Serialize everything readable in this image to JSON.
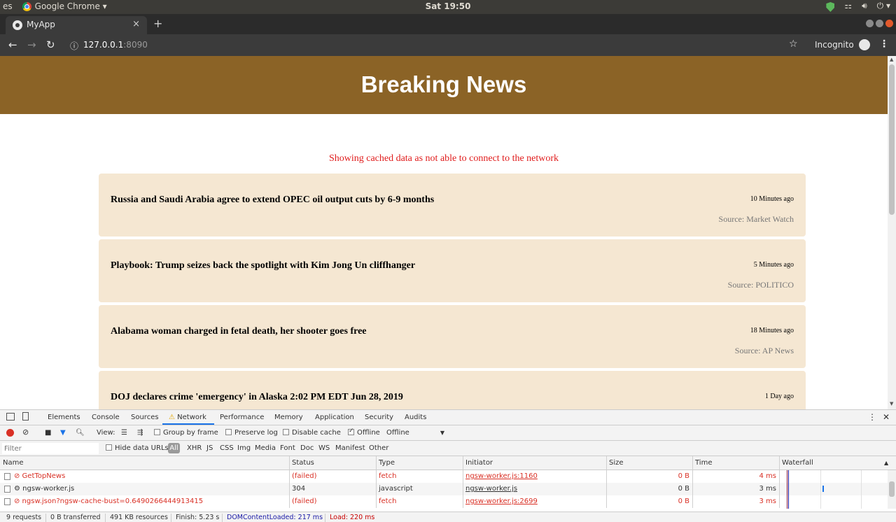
{
  "os": {
    "activities": "es",
    "app_name": "Google Chrome ▾",
    "clock": "Sat 19:50"
  },
  "browser": {
    "tab_title": "MyApp",
    "tab_close": "×",
    "new_tab": "+",
    "url_host": "127.0.0.1",
    "url_port": ":8090",
    "incognito_label": "Incognito"
  },
  "page": {
    "title": "Breaking News",
    "offline_message": "Showing cached data as not able to connect to the network",
    "articles": [
      {
        "headline": "Russia and Saudi Arabia agree to extend OPEC oil output cuts by 6-9 months",
        "ago": "10 Minutes ago",
        "source": "Source: Market Watch"
      },
      {
        "headline": "Playbook: Trump seizes back the spotlight with Kim Jong Un cliffhanger",
        "ago": "5 Minutes ago",
        "source": "Source: POLITICO"
      },
      {
        "headline": "Alabama woman charged in fetal death, her shooter goes free",
        "ago": "18 Minutes ago",
        "source": "Source: AP News"
      },
      {
        "headline": "DOJ declares crime 'emergency' in Alaska 2:02 PM EDT Jun 28, 2019",
        "ago": "1 Day ago",
        "source": ""
      }
    ]
  },
  "devtools": {
    "tabs": [
      "Elements",
      "Console",
      "Sources",
      "Network",
      "Performance",
      "Memory",
      "Application",
      "Security",
      "Audits"
    ],
    "active_tab": "Network",
    "toolbar": {
      "view_label": "View:",
      "group_by_frame": "Group by frame",
      "preserve_log": "Preserve log",
      "disable_cache": "Disable cache",
      "offline_checkbox": "Offline",
      "throttle_value": "Offline"
    },
    "filter": {
      "placeholder": "Filter",
      "hide_data_urls": "Hide data URLs",
      "all": "All",
      "types": [
        "XHR",
        "JS",
        "CSS",
        "Img",
        "Media",
        "Font",
        "Doc",
        "WS",
        "Manifest",
        "Other"
      ]
    },
    "columns": [
      "Name",
      "Status",
      "Type",
      "Initiator",
      "Size",
      "Time",
      "Waterfall"
    ],
    "rows": [
      {
        "name": "⊘ GetTopNews",
        "status": "(failed)",
        "type": "fetch",
        "initiator": "ngsw-worker.js:1160",
        "size": "0 B",
        "time": "4 ms",
        "failed": true
      },
      {
        "name": "⚙ ngsw-worker.js",
        "status": "304",
        "type": "javascript",
        "initiator": "ngsw-worker.js",
        "size": "0 B",
        "time": "3 ms",
        "failed": false
      },
      {
        "name": "⊘ ngsw.json?ngsw-cache-bust=0.6490266444913415",
        "status": "(failed)",
        "type": "fetch",
        "initiator": "ngsw-worker.js:2699",
        "size": "0 B",
        "time": "3 ms",
        "failed": true
      }
    ],
    "status_bar": {
      "requests": "9 requests",
      "transferred": "0 B transferred",
      "resources": "491 KB resources",
      "finish": "Finish: 5.23 s",
      "dom_loaded": "DOMContentLoaded: 217 ms",
      "load": "Load: 220 ms"
    },
    "colors": {
      "dom_loaded": "#1a1aa6",
      "load": "#c80000",
      "failed": "#d93025"
    }
  }
}
